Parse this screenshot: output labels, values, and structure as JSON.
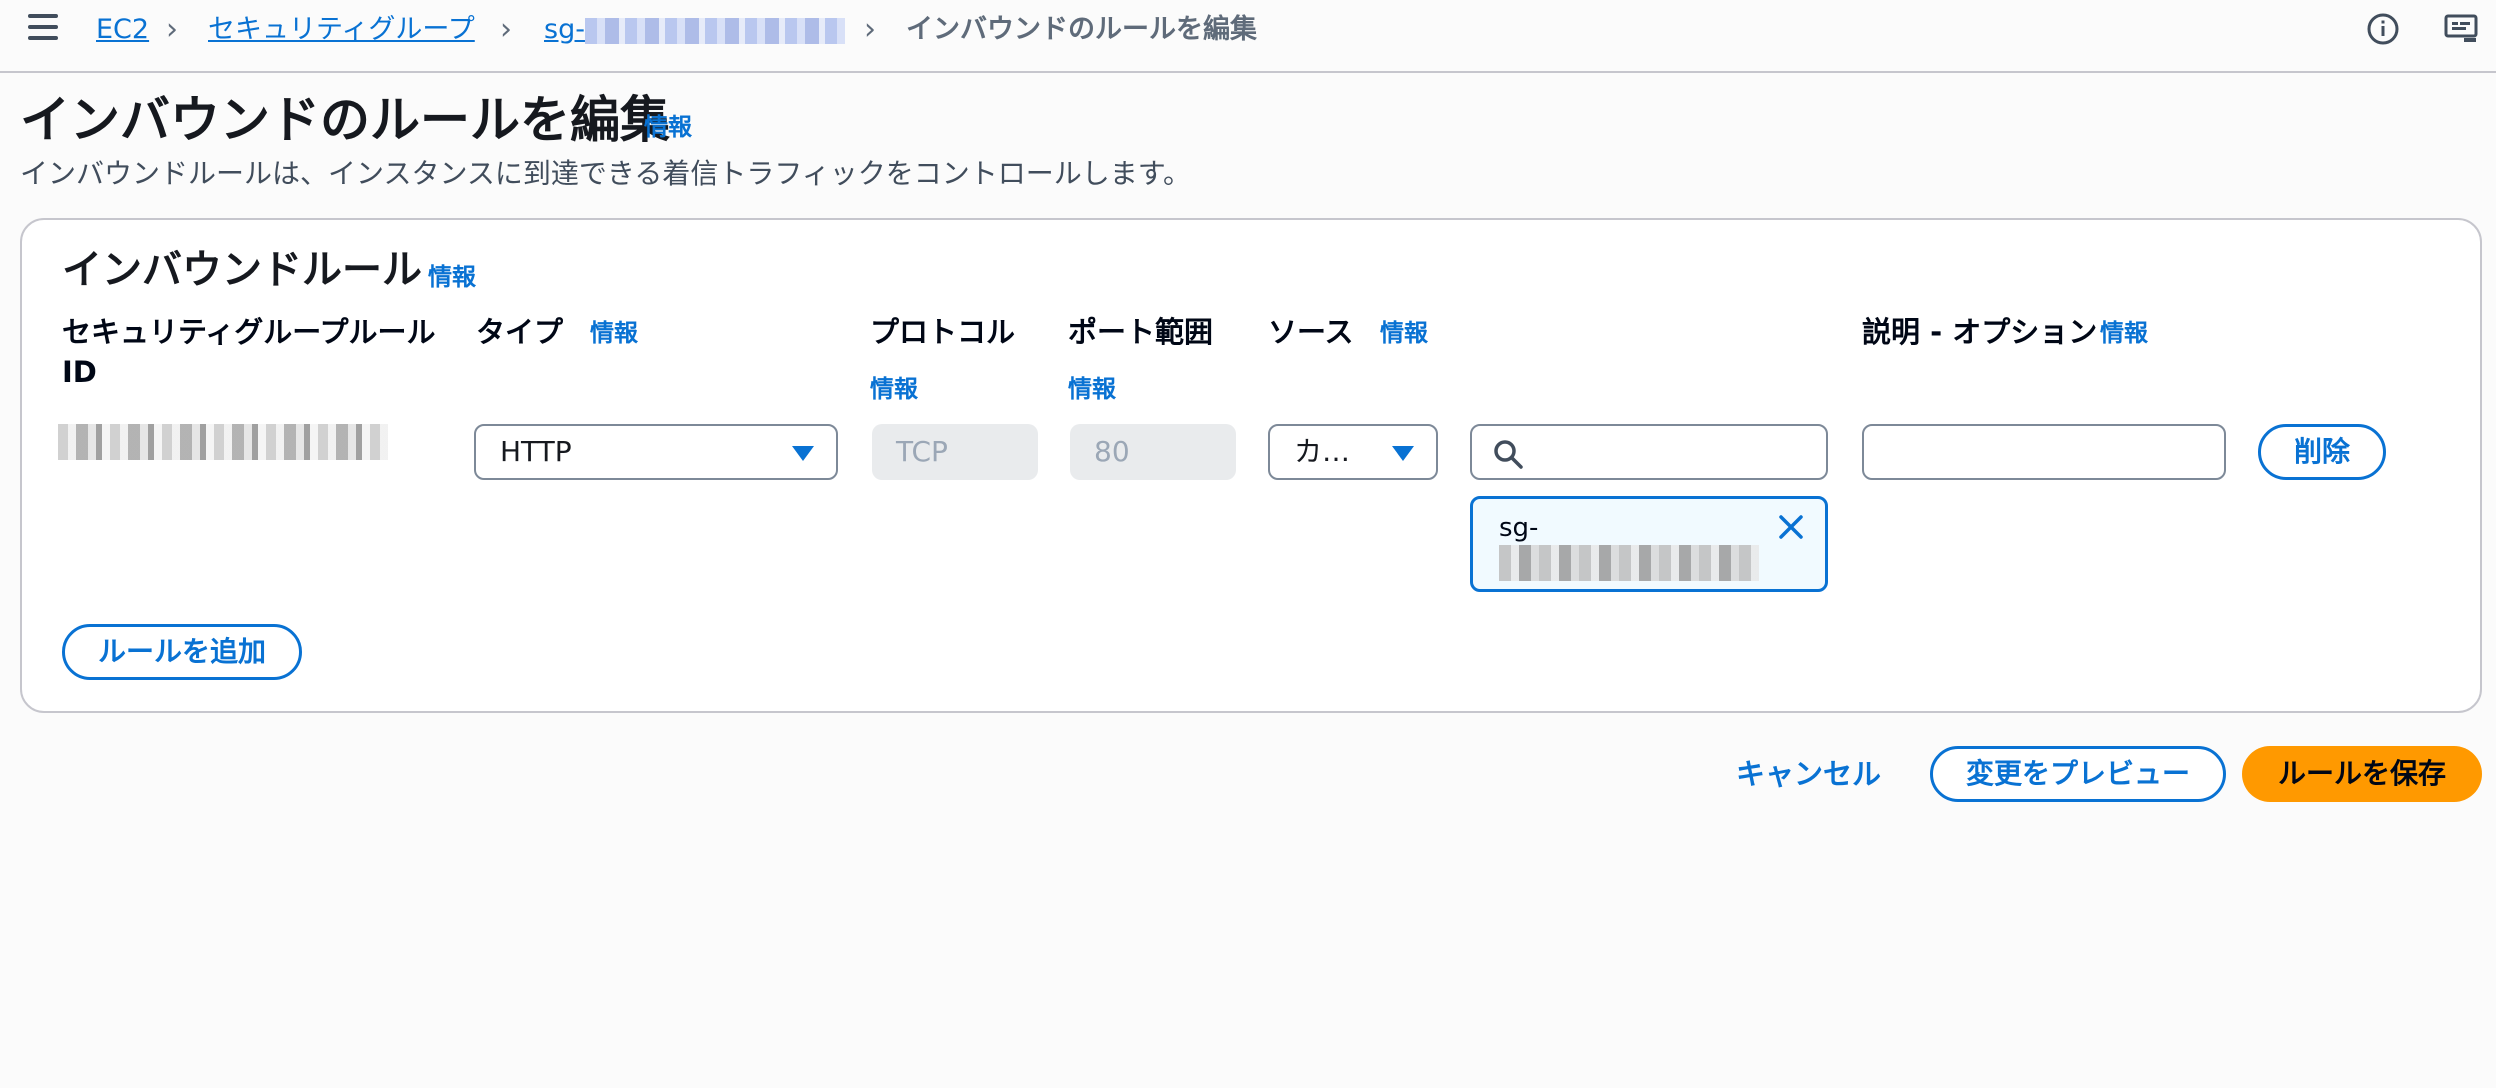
{
  "breadcrumb": {
    "ec2": "EC2",
    "security_groups": "セキュリティグループ",
    "sg_prefix": "sg-",
    "current": "インバウンドのルールを編集"
  },
  "icons": {
    "menu": "hamburger-menu-icon",
    "info": "info-circle-icon",
    "feedback": "feedback-screen-icon",
    "search": "search-icon",
    "close": "close-icon",
    "caret": "caret-down-icon"
  },
  "page": {
    "title": "インバウンドのルールを編集",
    "info": "情報",
    "description": "インバウンドルールは、インスタンスに到達できる着信トラフィックをコントロールします。"
  },
  "panel": {
    "title": "インバウンドルール",
    "info": "情報",
    "columns": {
      "rule_id_line1": "セキュリティグループルール",
      "rule_id_line2": "ID",
      "type": "タイプ",
      "type_info": "情報",
      "protocol": "プロトコル",
      "protocol_info": "情報",
      "port_range": "ポート範囲",
      "port_info": "情報",
      "source": "ソース",
      "source_info": "情報",
      "description": "説明 - オプション",
      "description_info": "情報"
    },
    "rule": {
      "type": "HTTP",
      "protocol": "TCP",
      "port": "80",
      "source_type": "カ…",
      "search_value": "",
      "description_value": "",
      "token_label": "sg-",
      "delete": "削除"
    },
    "add_rule": "ルールを追加"
  },
  "footer": {
    "cancel": "キャンセル",
    "preview": "変更をプレビュー",
    "save": "ルールを保存"
  },
  "colors": {
    "link": "#0972d3",
    "primary_button": "#ff9900",
    "border": "#c6c6cd"
  }
}
